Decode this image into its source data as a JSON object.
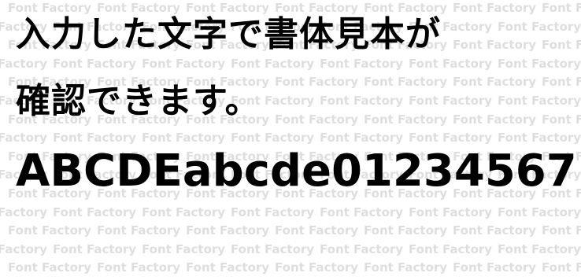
{
  "watermark": {
    "text": "Font Factory",
    "color": "#dedede"
  },
  "sample": {
    "line1": "入力した文字で書体見本が",
    "line2": "確認できます。",
    "line3": "ABCDEabcde01234567"
  }
}
